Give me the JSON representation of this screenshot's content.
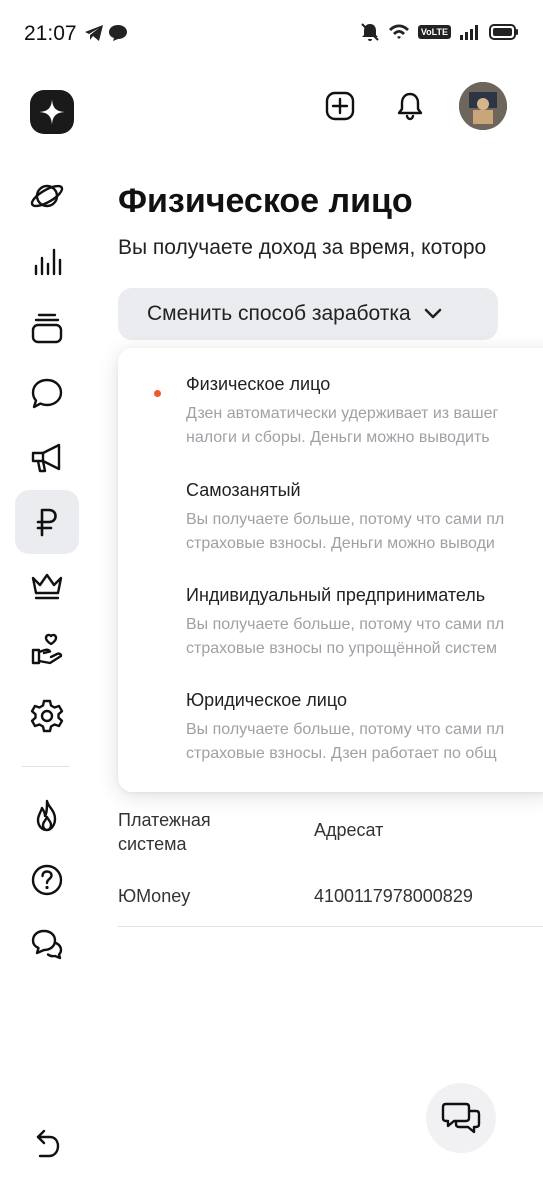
{
  "status_bar": {
    "time": "21:07",
    "network_badge": "VoLTE"
  },
  "header": {
    "logo_icon": "zen-star-icon",
    "actions": [
      "add-icon",
      "bell-icon",
      "avatar"
    ]
  },
  "sidebar": {
    "items": [
      {
        "icon": "planet-icon"
      },
      {
        "icon": "stats-bars-icon"
      },
      {
        "icon": "stack-icon"
      },
      {
        "icon": "comment-bubble-icon"
      },
      {
        "icon": "megaphone-icon"
      },
      {
        "icon": "ruble-icon",
        "active": true
      },
      {
        "icon": "crown-icon"
      },
      {
        "icon": "hand-heart-icon"
      },
      {
        "icon": "gear-icon"
      },
      {
        "icon": "flame-icon"
      },
      {
        "icon": "help-icon"
      },
      {
        "icon": "chat-bubbles-icon"
      }
    ],
    "back_icon": "back-arrow-icon"
  },
  "main": {
    "title": "Физическое лицо",
    "subtitle": "Вы получаете доход за время, которо",
    "change_button": "Сменить способ заработка"
  },
  "dropdown": {
    "items": [
      {
        "title": "Физическое лицо",
        "desc1": "Дзен автоматически удерживает из вашег",
        "desc2": "налоги и сборы. Деньги можно выводить",
        "selected": true
      },
      {
        "title": "Самозанятый",
        "desc1": "Вы получаете больше, потому что сами пл",
        "desc2": "страховые взносы. Деньги можно выводи"
      },
      {
        "title": "Индивидуальный предприниматель",
        "desc1": "Вы получаете больше, потому что сами пл",
        "desc2": "страховые взносы по упрощённой систем"
      },
      {
        "title": "Юридическое лицо",
        "desc1": "Вы получаете больше, потому что сами пл",
        "desc2": "страховые взносы. Дзен работает по общ"
      }
    ]
  },
  "table": {
    "headers": [
      "Платежная система",
      "Адресат"
    ],
    "rows": [
      [
        "ЮMoney",
        "4100117978000829"
      ]
    ]
  },
  "colors": {
    "accent_dot": "#f05a28",
    "button_bg": "#ebecef",
    "muted_text": "#a0a0a6"
  }
}
